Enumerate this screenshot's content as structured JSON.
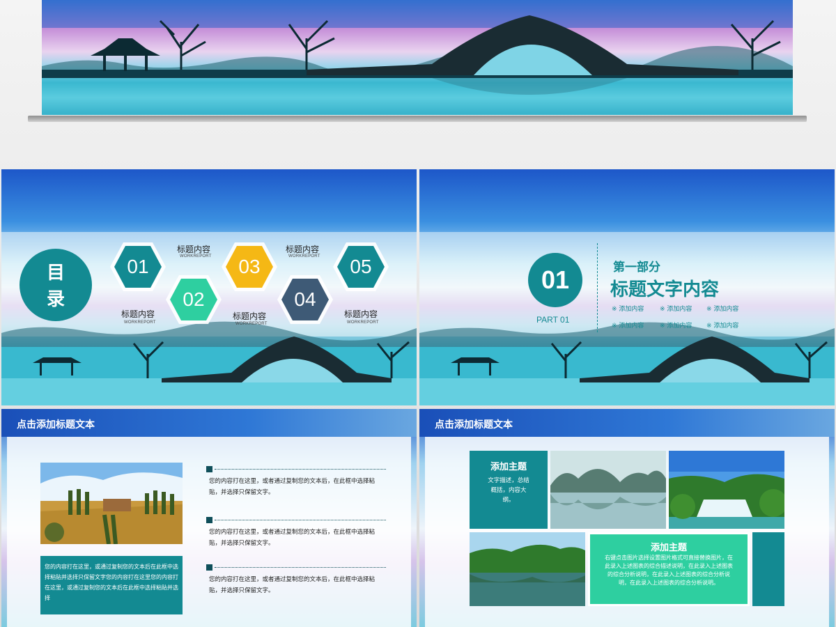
{
  "toc": {
    "heading_char1": "目",
    "heading_char2": "录",
    "items": [
      {
        "num": "01",
        "color": "#138a92",
        "title": "标题内容",
        "sub": "WORKREPORT"
      },
      {
        "num": "02",
        "color": "#2ecfa0",
        "title": "标题内容",
        "sub": "WORKREPORT"
      },
      {
        "num": "03",
        "color": "#f5b815",
        "title": "标题内容",
        "sub": "WORKREPORT"
      },
      {
        "num": "04",
        "color": "#3e5a76",
        "title": "标题内容",
        "sub": "WORKREPORT"
      },
      {
        "num": "05",
        "color": "#138a92",
        "title": "标题内容",
        "sub": "WORKREPORT"
      }
    ]
  },
  "part": {
    "num": "01",
    "part_label": "PART 01",
    "subtitle": "第一部分",
    "title": "标题文字内容",
    "bullets": [
      "※ 添加内容",
      "※ 添加内容",
      "※ 添加内容",
      "※ 添加内容",
      "※ 添加内容",
      "※ 添加内容"
    ]
  },
  "text_slide": {
    "header": "点击添加标题文本",
    "caption": "您的内容打在这里，或通过复制您的文本后在此框中选择粘贴并选择只保留文字您的内容打在这里您的内容打在这里，或通过复制您的文本后在此框中选择粘贴并选择",
    "paragraphs": [
      {
        "line1": "您的内容打在这里，或者通过复制您的文本后，在此框中选择粘",
        "line2": "贴，并选择只保留文字。"
      },
      {
        "line1": "您的内容打在这里，或者通过复制您的文本后，在此框中选择粘",
        "line2": "贴，并选择只保留文字。"
      },
      {
        "line1": "您的内容打在这里，或者通过复制您的文本后，在此框中选择粘",
        "line2": "贴，并选择只保留文字。"
      }
    ]
  },
  "gallery_slide": {
    "header": "点击添加标题文本",
    "box1_title": "添加主题",
    "box1_text": "文字描述，总结概括，内容大纲。",
    "box2_title": "添加主题",
    "box2_text": "右键点击图片选择设置图片格式可直接替换图片，在此录入上述图表的综合描述说明，在此录入上述图表的综合分析说明，在此录入上述图表的综合分析说明，在此录入上述图表的综合分析说明。"
  },
  "colors": {
    "teal": "#138a92",
    "mint": "#2ecfa0",
    "yellow": "#f5b815",
    "slate": "#3e5a76",
    "header_blue": "#1a4fb8"
  }
}
